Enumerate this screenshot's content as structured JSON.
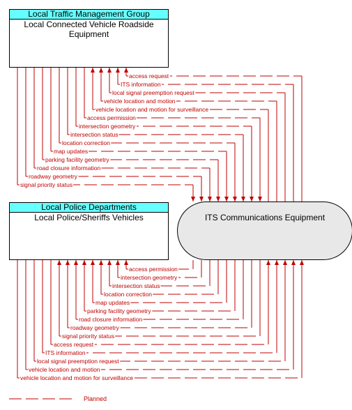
{
  "colors": {
    "flow": "#c00000",
    "header": "#66ffff",
    "its_fill": "#e8e8e8"
  },
  "nodes": {
    "rse": {
      "group": "Local Traffic Management Group",
      "title": "Local Connected Vehicle Roadside Equipment"
    },
    "police": {
      "group": "Local Police Departments",
      "title": "Local Police/Sheriffs Vehicles"
    },
    "its": {
      "title": "ITS Communications Equipment"
    }
  },
  "flows_top": [
    {
      "label": "access request",
      "direction": "to-rse"
    },
    {
      "label": "ITS information",
      "direction": "to-rse"
    },
    {
      "label": "local signal preemption request",
      "direction": "to-rse"
    },
    {
      "label": "vehicle location and motion",
      "direction": "to-rse"
    },
    {
      "label": "vehicle location and motion for surveillance",
      "direction": "to-rse"
    },
    {
      "label": "access permission",
      "direction": "to-its"
    },
    {
      "label": "intersection geometry",
      "direction": "to-its"
    },
    {
      "label": "intersection status",
      "direction": "to-its"
    },
    {
      "label": "location correction",
      "direction": "to-its"
    },
    {
      "label": "map updates",
      "direction": "to-its"
    },
    {
      "label": "parking facility geometry",
      "direction": "to-its"
    },
    {
      "label": "road closure information",
      "direction": "to-its"
    },
    {
      "label": "roadway geometry",
      "direction": "to-its"
    },
    {
      "label": "signal priority status",
      "direction": "to-its"
    }
  ],
  "flows_bottom": [
    {
      "label": "access permission",
      "direction": "to-police"
    },
    {
      "label": "intersection geometry",
      "direction": "to-police"
    },
    {
      "label": "intersection status",
      "direction": "to-police"
    },
    {
      "label": "location correction",
      "direction": "to-police"
    },
    {
      "label": "map updates",
      "direction": "to-police"
    },
    {
      "label": "parking facility geometry",
      "direction": "to-police"
    },
    {
      "label": "road closure information",
      "direction": "to-police"
    },
    {
      "label": "roadway geometry",
      "direction": "to-police"
    },
    {
      "label": "signal priority status",
      "direction": "to-police"
    },
    {
      "label": "access request",
      "direction": "to-its"
    },
    {
      "label": "ITS information",
      "direction": "to-its"
    },
    {
      "label": "local signal preemption request",
      "direction": "to-its"
    },
    {
      "label": "vehicle location and motion",
      "direction": "to-its"
    },
    {
      "label": "vehicle location and motion for surveillance",
      "direction": "to-its"
    }
  ],
  "legend": {
    "label": "Planned"
  }
}
